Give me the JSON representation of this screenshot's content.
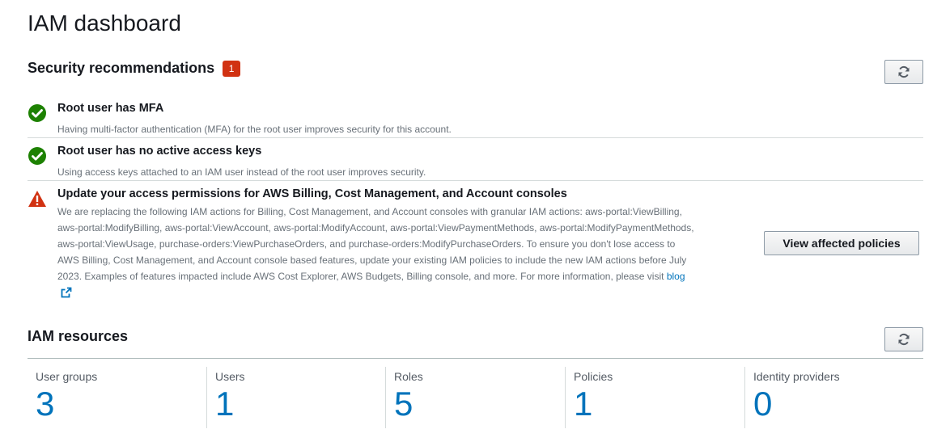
{
  "page": {
    "title": "IAM dashboard"
  },
  "security": {
    "header": "Security recommendations",
    "badge_count": "1",
    "recommendations": [
      {
        "status": "success",
        "icon": "check-circle-icon",
        "title": "Root user has MFA",
        "description": "Having multi-factor authentication (MFA) for the root user improves security for this account."
      },
      {
        "status": "success",
        "icon": "check-circle-icon",
        "title": "Root user has no active access keys",
        "description": "Using access keys attached to an IAM user instead of the root user improves security."
      },
      {
        "status": "warning",
        "icon": "warning-triangle-icon",
        "title": "Update your access permissions for AWS Billing, Cost Management, and Account consoles",
        "description": "We are replacing the following IAM actions for Billing, Cost Management, and Account consoles with granular IAM actions: aws-portal:ViewBilling, aws-portal:ModifyBilling, aws-portal:ViewAccount, aws-portal:ModifyAccount, aws-portal:ViewPaymentMethods, aws-portal:ModifyPaymentMethods, aws-portal:ViewUsage, purchase-orders:ViewPurchaseOrders, and purchase-orders:ModifyPurchaseOrders. To ensure you don't lose access to AWS Billing, Cost Management, and Account console based features, update your existing IAM policies to include the new IAM actions before July 2023. Examples of features impacted include AWS Cost Explorer, AWS Budgets, Billing console, and more. For more information, please visit",
        "link_text": "blog",
        "button_label": "View affected policies"
      }
    ]
  },
  "resources": {
    "header": "IAM resources",
    "items": [
      {
        "label": "User groups",
        "count": "3"
      },
      {
        "label": "Users",
        "count": "1"
      },
      {
        "label": "Roles",
        "count": "5"
      },
      {
        "label": "Policies",
        "count": "1"
      },
      {
        "label": "Identity providers",
        "count": "0"
      }
    ]
  },
  "colors": {
    "success": "#1d8102",
    "warning": "#d13212",
    "link": "#0073bb",
    "badge": "#d13212"
  }
}
